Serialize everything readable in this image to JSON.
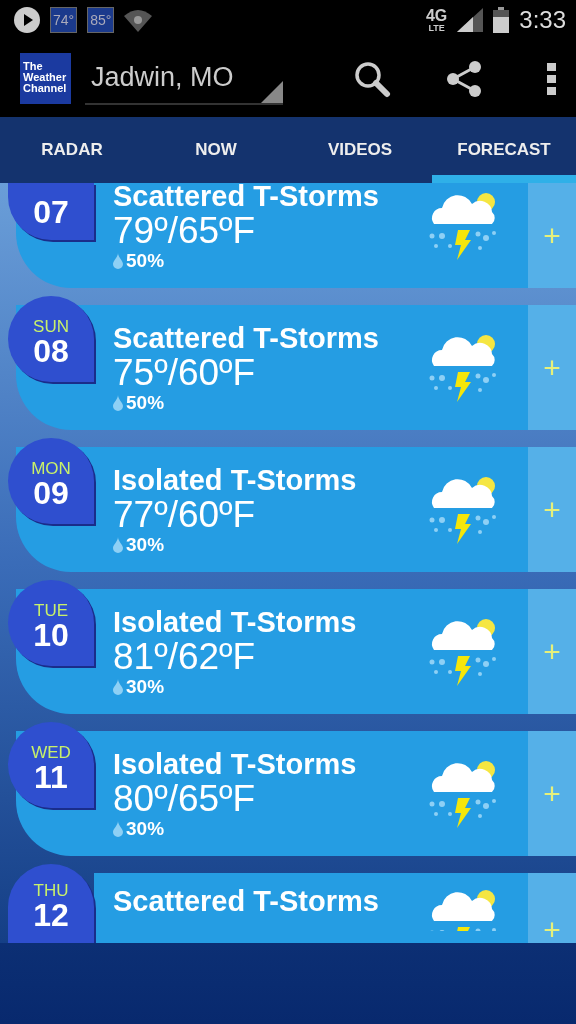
{
  "status_bar": {
    "notifications": [
      "74°",
      "85°"
    ],
    "network": "4G",
    "network_sub": "LTE",
    "time": "3:33"
  },
  "app_bar": {
    "logo": "The\nWeather\nChannel",
    "location": "Jadwin, MO"
  },
  "tabs": [
    {
      "label": "RADAR",
      "selected": false
    },
    {
      "label": "NOW",
      "selected": false
    },
    {
      "label": "VIDEOS",
      "selected": false
    },
    {
      "label": "FORECAST",
      "selected": true
    }
  ],
  "days": [
    {
      "date": "07",
      "condition": "Scattered T-Storms",
      "temps": "79º/65ºF",
      "precip": "50%",
      "expand": "+"
    },
    {
      "day": "SUN",
      "date": "08",
      "condition": "Scattered T-Storms",
      "temps": "75º/60ºF",
      "precip": "50%",
      "expand": "+"
    },
    {
      "day": "MON",
      "date": "09",
      "condition": "Isolated T-Storms",
      "temps": "77º/60ºF",
      "precip": "30%",
      "expand": "+"
    },
    {
      "day": "TUE",
      "date": "10",
      "condition": "Isolated T-Storms",
      "temps": "81º/62ºF",
      "precip": "30%",
      "expand": "+"
    },
    {
      "day": "WED",
      "date": "11",
      "condition": "Isolated T-Storms",
      "temps": "80º/65ºF",
      "precip": "30%",
      "expand": "+"
    },
    {
      "day": "THU",
      "date": "12",
      "condition": "Scattered T-Storms",
      "expand": "+"
    }
  ]
}
